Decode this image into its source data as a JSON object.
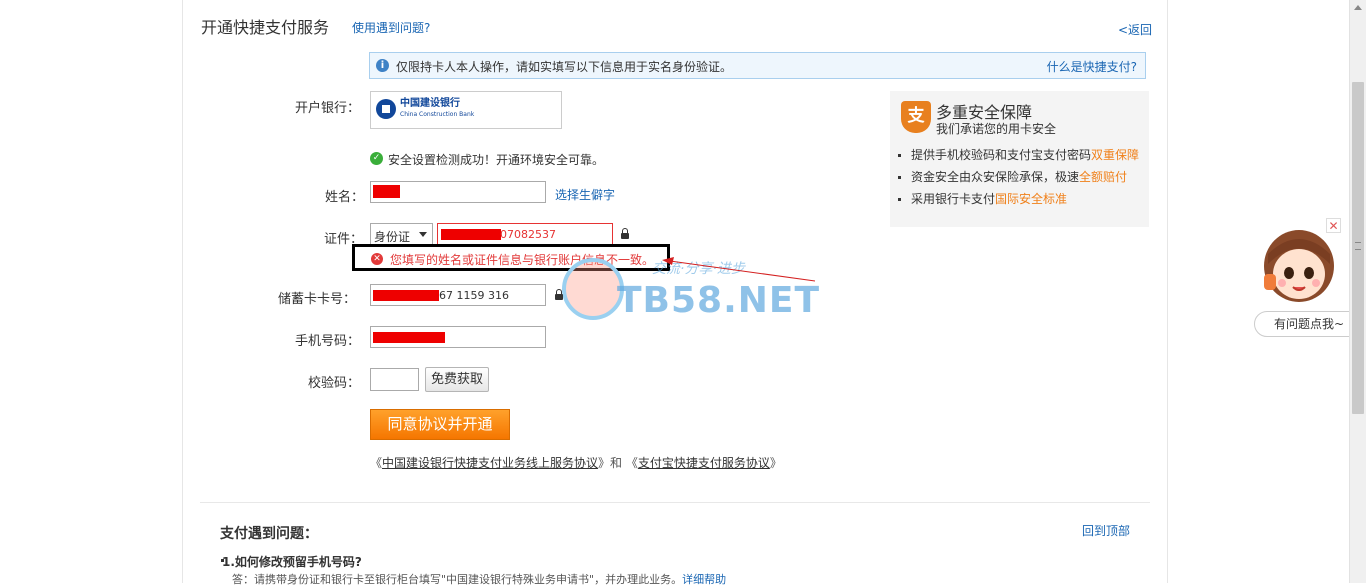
{
  "header": {
    "title": "开通快捷支付服务",
    "help_link": "使用遇到问题?",
    "back_link": "<返回"
  },
  "notice": {
    "text": "仅限持卡人本人操作，请如实填写以下信息用于实名身份验证。",
    "link": "什么是快捷支付?"
  },
  "form": {
    "bank_label": "开户银行：",
    "bank_name": "中国建设银行",
    "bank_name_en": "China Construction Bank",
    "security_ok": "安全设置检测成功！开通环境安全可靠。",
    "name_label": "姓名：",
    "rare_char_link": "选择生僻字",
    "id_label": "证件：",
    "id_type": "身份证",
    "id_number_visible": "07082537",
    "error_message": "您填写的姓名或证件信息与银行账户信息不一致。",
    "card_label": "储蓄卡卡号：",
    "card_number_visible": "67 1159 316",
    "phone_label": "手机号码：",
    "code_label": "校验码：",
    "get_code_button": "免费获取",
    "submit_button": "同意协议并开通",
    "agreement_prefix": "《",
    "agreement_1": "中国建设银行快捷支付业务线上服务协议",
    "agreement_mid": "》和 《",
    "agreement_2": "支付宝快捷支付服务协议",
    "agreement_suffix": "》"
  },
  "security_panel": {
    "title": "多重安全保障",
    "subtitle": "我们承诺您的用卡安全",
    "items": [
      {
        "text": "提供手机校验码和支付宝支付密码",
        "highlight": "双重保障"
      },
      {
        "text": "资金安全由众安保险承保，极速",
        "highlight": "全额赔付"
      },
      {
        "text": "采用银行卡支付",
        "highlight": "国际安全标准"
      }
    ]
  },
  "faq": {
    "title": "支付遇到问题：",
    "back_top": "回到顶部",
    "q1": "1.如何修改预留手机号码?",
    "a1": "答：请携带身份证和银行卡至银行柜台填写\"中国建设银行特殊业务申请书\"，并办理此业务。",
    "a1_link": "详细帮助"
  },
  "watermark": {
    "text": "TB58.NET",
    "slogan": "交流·分享·进步"
  },
  "helper": {
    "bubble": "有问题点我~",
    "close": "✕"
  },
  "colors": {
    "link": "#1a66b3",
    "error": "#e23a3a",
    "orange_button": "#f57600",
    "highlight": "#f0801a"
  }
}
